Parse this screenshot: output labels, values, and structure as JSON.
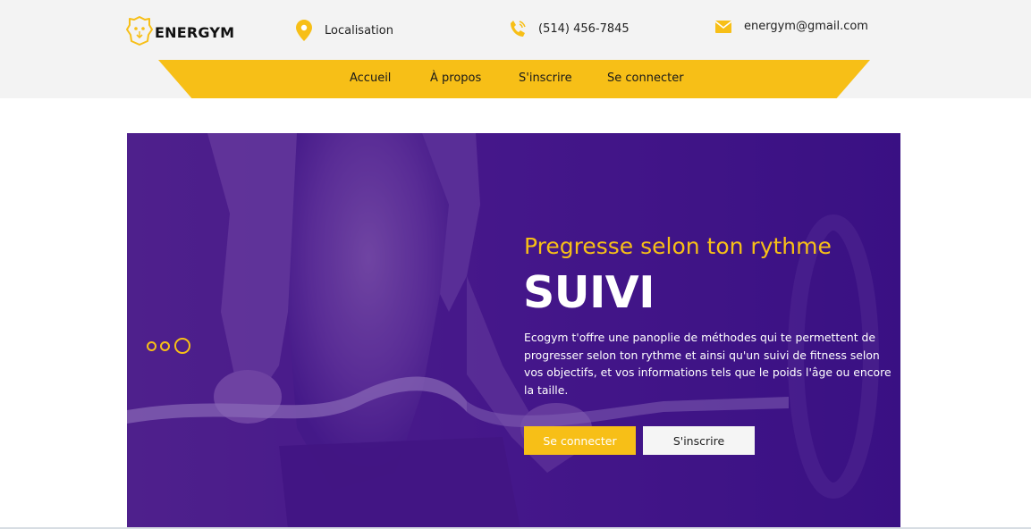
{
  "brand": {
    "name": "ENERGYM"
  },
  "header": {
    "location": "Localisation",
    "phone": "(514) 456-7845",
    "email": "energym@gmail.com"
  },
  "nav": [
    "Accueil",
    "À propos",
    "S'inscrire",
    "Se connecter"
  ],
  "hero": {
    "subtitle": "Pregresse selon ton rythme",
    "title": "SUIVI",
    "description": "Ecogym t'offre une panoplie de méthodes qui te permettent de progresser selon ton rythme et ainsi qu'un suivi de fitness selon vos objectifs, et vos informations tels que le poids l'âge ou encore la taille.",
    "primary_button": "Se connecter",
    "secondary_button": "S'inscrire",
    "slide_count": 3,
    "active_slide": 3
  },
  "colors": {
    "accent": "#f7bf17",
    "hero_overlay": "#3d1480",
    "topbar": "#f3f3f3"
  },
  "icons": [
    "lion-logo-icon",
    "location-pin-icon",
    "phone-icon",
    "envelope-icon"
  ]
}
